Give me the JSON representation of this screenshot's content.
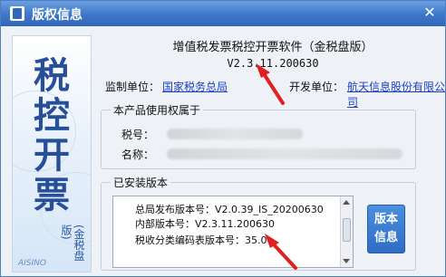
{
  "window": {
    "title": "版权信息",
    "close_label": "✕"
  },
  "banner": {
    "chars": "税控开票",
    "sub": "(金税盘版)",
    "brand": "AISINO"
  },
  "header": {
    "product": "增值税发票税控开票软件（金税盘版）",
    "version": "V2.3.11.200630",
    "supervisor_label": "监制单位：",
    "supervisor": "国家税务总局",
    "developer_label": "开发单位：",
    "developer": "航天信息股份有限公司"
  },
  "owner": {
    "title": "本产品使用权属于",
    "tax_id_label": "税号：",
    "name_label": "名称："
  },
  "installed": {
    "title": "已安装版本",
    "lines": [
      "总局发布版本号：V2.0.39_IS_20200630",
      "内部版本号：V2.3.11.200630",
      "税收分类编码表版本号：35.0"
    ],
    "button_label": "版本信息"
  },
  "colors": {
    "title_bar": "#3d77c9",
    "link": "#1b3fc4",
    "annotation": "#e02020"
  }
}
